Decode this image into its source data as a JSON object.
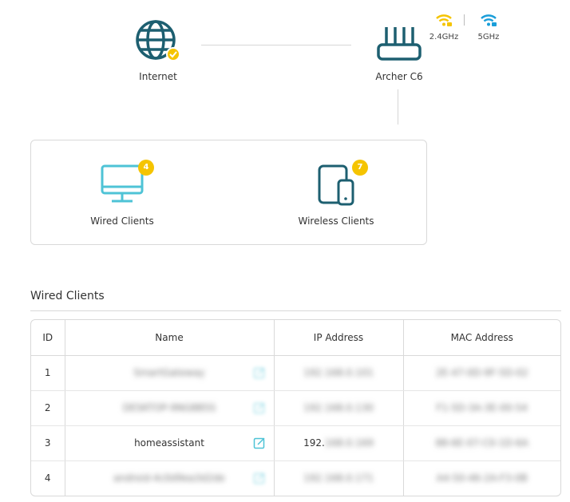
{
  "topology": {
    "internet_label": "Internet",
    "router_label": "Archer C6",
    "bands": [
      {
        "label": "2.4GHz",
        "color": "#f5c400"
      },
      {
        "label": "5GHz",
        "color": "#1a9ed9"
      }
    ]
  },
  "clients": {
    "wired": {
      "label": "Wired Clients",
      "count": "4"
    },
    "wireless": {
      "label": "Wireless Clients",
      "count": "7"
    }
  },
  "section_title": "Wired Clients",
  "table": {
    "headers": [
      "ID",
      "Name",
      "IP Address",
      "MAC Address"
    ],
    "rows": [
      {
        "id": "1",
        "name": "SmartGateway",
        "ip": "192.168.0.101",
        "mac": "2E-47-0D-9F-5D-02"
      },
      {
        "id": "2",
        "name": "DESKTOP-9NG8B5S",
        "ip": "192.168.0.130",
        "mac": "F1-5D-3A-3E-00-54"
      },
      {
        "id": "3",
        "name": "homeassistant",
        "ip_prefix": "192.",
        "ip_rest": "168.0.169",
        "mac": "88-6E-07-C0-1D-6A"
      },
      {
        "id": "4",
        "name": "android-4c0d9ea3d2de",
        "ip": "192.168.0.171",
        "mac": "A4-50-46-2A-F3-0B"
      }
    ]
  },
  "colors": {
    "accent_teal": "#1d5f70",
    "wired_icon": "#4ec3d6",
    "badge": "#f5c400",
    "check": "#f5c400"
  }
}
